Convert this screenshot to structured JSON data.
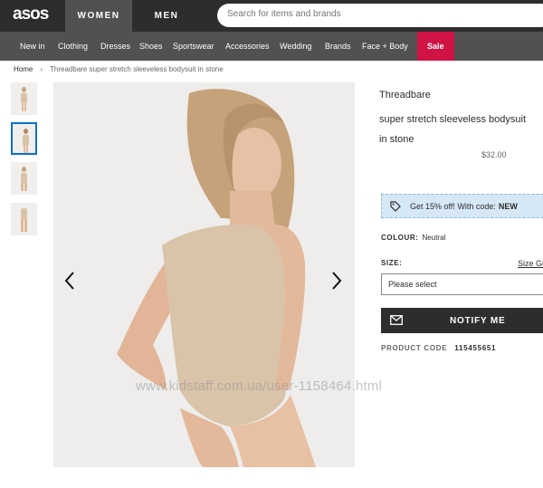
{
  "brand": {
    "logo": "asos"
  },
  "header": {
    "tabs": [
      {
        "label": "WOMEN"
      },
      {
        "label": "MEN"
      }
    ],
    "search": {
      "placeholder": "Search for items and brands"
    }
  },
  "nav": {
    "items": [
      {
        "label": "New in"
      },
      {
        "label": "Clothing"
      },
      {
        "label": "Dresses"
      },
      {
        "label": "Shoes"
      },
      {
        "label": "Sportswear"
      },
      {
        "label": "Accessories"
      },
      {
        "label": "Wedding"
      },
      {
        "label": "Brands"
      },
      {
        "label": "Face + Body"
      },
      {
        "label": "Sale"
      }
    ]
  },
  "breadcrumb": {
    "home": "Home",
    "separator": "›",
    "current": "Threadbare super stretch sleeveless bodysuit in stone"
  },
  "gallery": {
    "thumbnail_count": 4,
    "active_index": 1,
    "watermark": "www.kidstaff.com.ua/user-1158464.html"
  },
  "product": {
    "title_lines": [
      "Threadbare",
      "super stretch sleeveless  bodysuit",
      "in stone"
    ],
    "price": "$32.00",
    "promo": {
      "text": "Get 15% off! With code:",
      "code": "NEW"
    },
    "colour_label": "COLOUR:",
    "colour_value": "Neutral",
    "size_label": "SIZE:",
    "size_guide": "Size Guide",
    "size_select": "Please select",
    "notify_button": "NOTIFY ME",
    "product_code_label": "PRODUCT CODE",
    "product_code": "115455651"
  },
  "colors": {
    "topbar": "#2d2d2d",
    "navbar": "#525050",
    "sale": "#d01345",
    "promo_bg": "#d6e8f5",
    "active_thumb": "#0770cf"
  }
}
